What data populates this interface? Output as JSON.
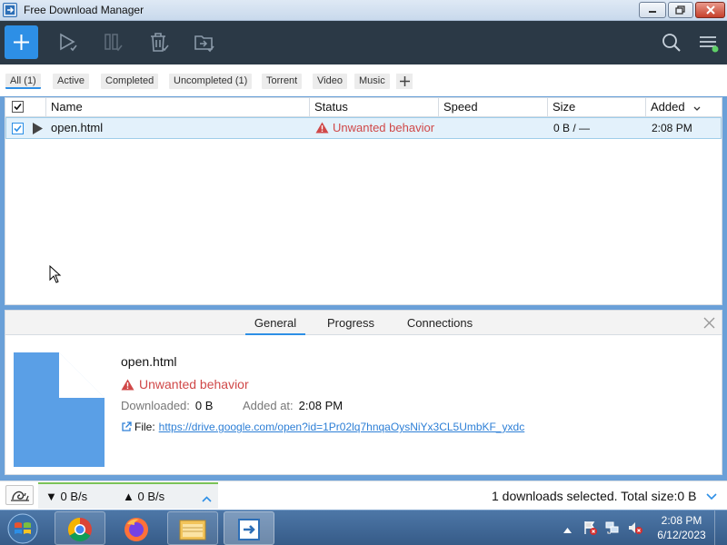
{
  "window": {
    "title": "Free Download Manager"
  },
  "toolbar": {
    "icons": [
      "add-icon",
      "resume-icon",
      "pause-icon",
      "delete-icon",
      "move-icon",
      "search-icon",
      "menu-icon"
    ]
  },
  "filters": {
    "items": [
      {
        "label": "All (1)",
        "active": true
      },
      {
        "label": "Active"
      },
      {
        "label": "Completed"
      },
      {
        "label": "Uncompleted (1)"
      },
      {
        "label": "Torrent"
      },
      {
        "label": "Video"
      },
      {
        "label": "Music"
      }
    ]
  },
  "table": {
    "headers": {
      "name": "Name",
      "status": "Status",
      "speed": "Speed",
      "size": "Size",
      "added": "Added"
    },
    "rows": [
      {
        "name": "open.html",
        "status": "Unwanted behavior",
        "speed": "",
        "size": "0 B / —",
        "added": "2:08 PM",
        "checked": true
      }
    ]
  },
  "details": {
    "tabs": [
      "General",
      "Progress",
      "Connections"
    ],
    "active_tab": "General",
    "filename": "open.html",
    "status": "Unwanted behavior",
    "downloaded_label": "Downloaded:",
    "downloaded_value": "0 B",
    "added_label": "Added at:",
    "added_value": "2:08 PM",
    "file_label": "File:",
    "file_url": "https://drive.google.com/open?id=1Pr02lq7hnqaOysNiYx3CL5UmbKF_yxdc"
  },
  "statusbar": {
    "download_speed": "0 B/s",
    "upload_speed": "0 B/s",
    "selection_info": "1 downloads selected. Total size:0 B"
  },
  "taskbar": {
    "apps": [
      "chrome-icon",
      "firefox-icon",
      "explorer-icon",
      "fdm-icon"
    ],
    "time": "2:08 PM",
    "date": "6/12/2023"
  },
  "colors": {
    "accent": "#2d8fe6",
    "toolbar_bg": "#2b3946",
    "warning": "#d04848",
    "speed_bar": "#79c257"
  }
}
